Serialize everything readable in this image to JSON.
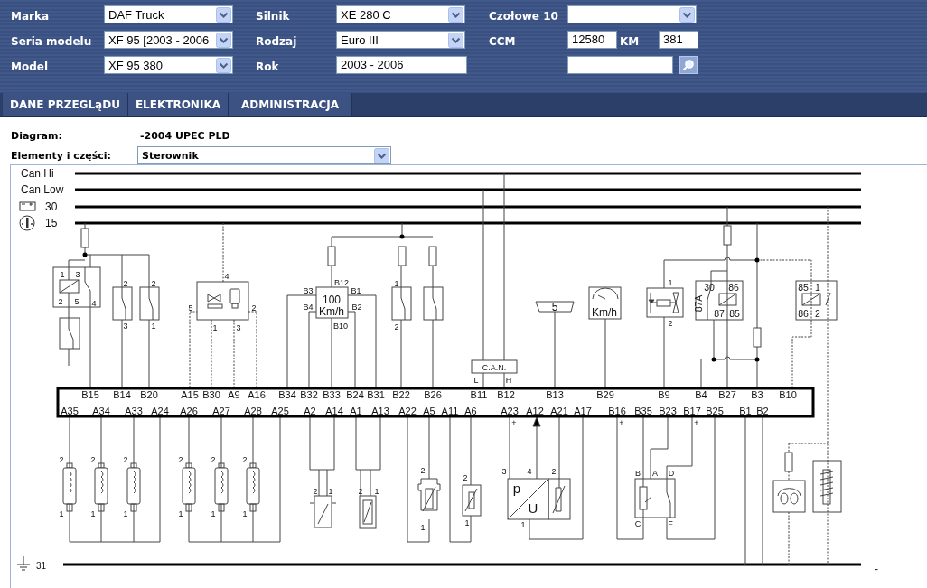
{
  "filter_rows": [
    [
      {
        "kind": "dropdown",
        "label": "Marka",
        "value": "DAF Truck"
      },
      {
        "kind": "dropdown",
        "label": "Silnik",
        "value": "XE 280 C"
      },
      {
        "kind": "dropdown",
        "label": "Czołowe 10"
      }
    ],
    [
      {
        "kind": "dropdown",
        "label": "Seria modelu",
        "value": "XF 95 [2003 - 2006"
      },
      {
        "kind": "dropdown",
        "label": "Rodzaj",
        "value": "Euro III"
      },
      {
        "kind": "ccm",
        "label": "CCM",
        "value": "12580",
        "unit": "KM",
        "value2": "381"
      }
    ],
    [
      {
        "kind": "dropdown",
        "label": "Model",
        "value": "XF 95 380"
      },
      {
        "kind": "text",
        "label": "Rok",
        "value": "2003 - 2006"
      },
      {
        "kind": "search"
      }
    ]
  ],
  "tabs": [
    {
      "label": "DANE PRZEGLąDU"
    },
    {
      "label": "ELEKTRONIKA"
    },
    {
      "label": "ADMINISTRACJA"
    }
  ],
  "info": {
    "diagram_label": "Diagram:",
    "diagram_value": "-2004 UPEC PLD",
    "parts_label": "Elementy i części:",
    "parts_value": "Sterownik"
  },
  "diagram": {
    "buses": [
      {
        "label": "Can Hi"
      },
      {
        "label": "Can Low"
      },
      {
        "label": "30"
      },
      {
        "label": "15"
      }
    ],
    "ground_label": "31",
    "ecu_pins_top": [
      "B15",
      "B14",
      "B20",
      "A15",
      "B30",
      "A9",
      "A16",
      "B34",
      "B32",
      "B33",
      "B24",
      "B31",
      "B22",
      "B26",
      "B11",
      "B12",
      "B13",
      "B29",
      "B9",
      "B4",
      "B27",
      "B3",
      "B10"
    ],
    "ecu_pins_bottom": [
      "A35",
      "A34",
      "A33",
      "A24",
      "A26",
      "A27",
      "A28",
      "A25",
      "A2",
      "A14",
      "A1",
      "A13",
      "A22",
      "A5",
      "A11",
      "A6",
      "A23",
      "A12",
      "A21",
      "A17",
      "B16",
      "B35",
      "B23",
      "B17",
      "B25",
      "B1",
      "B2"
    ],
    "components": [
      {
        "labels": [
          "1",
          "3",
          "2",
          "5",
          "4"
        ]
      },
      {
        "labels": [
          "2",
          "3"
        ]
      },
      {
        "labels": [
          "2",
          "1"
        ]
      },
      {
        "labels": [
          "4",
          "5",
          "2",
          "1",
          "3"
        ]
      },
      {
        "labels": [
          "B12",
          "B3",
          "B1",
          "100",
          "Km/h",
          "B4",
          "B2",
          "B10"
        ]
      },
      {
        "labels": [
          "1",
          "2"
        ]
      },
      {
        "labels": [
          "C.A.N.",
          "L",
          "H"
        ]
      },
      {
        "labels": [
          "5"
        ]
      },
      {
        "labels": [
          "Km/h"
        ]
      },
      {
        "labels": [
          "1",
          "2"
        ]
      },
      {
        "labels": [
          "30",
          "86",
          "87A",
          "87",
          "85"
        ]
      },
      {
        "labels": [
          "85",
          "1",
          "86",
          "2"
        ]
      },
      {
        "labels": [
          "2",
          "1"
        ]
      },
      {
        "labels": [
          "2",
          "1"
        ]
      },
      {
        "labels": [
          "2",
          "1"
        ]
      },
      {
        "labels": [
          "2",
          "1"
        ]
      },
      {
        "labels": [
          "2",
          "1"
        ]
      },
      {
        "labels": [
          "2",
          "1"
        ]
      },
      {
        "labels": [
          "2",
          "1"
        ]
      },
      {
        "labels": [
          "2",
          "1"
        ]
      },
      {
        "labels": [
          "2",
          "1"
        ]
      },
      {
        "labels": [
          "2",
          "1"
        ]
      },
      {
        "labels": [
          "3",
          "4",
          "2",
          "1",
          "p",
          "U"
        ]
      },
      {
        "labels": [
          "B",
          "A",
          "D",
          "C",
          "F"
        ]
      }
    ],
    "plus_marks": [
      "+",
      "+",
      "+"
    ],
    "end_mark": "-"
  }
}
